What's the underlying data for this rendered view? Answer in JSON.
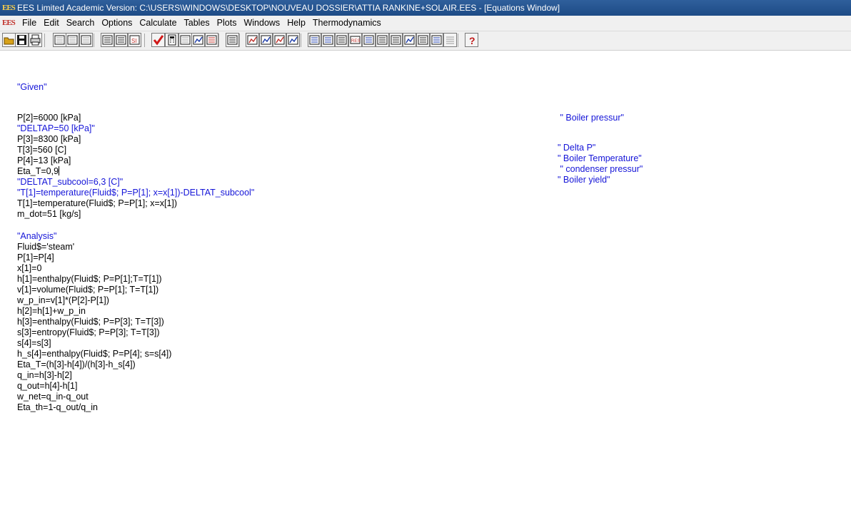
{
  "window": {
    "title": "EES Limited Academic Version:  C:\\USERS\\WINDOWS\\DESKTOP\\NOUVEAU DOSSIER\\ATTIA RANKINE+SOLAIR.EES - [Equations Window]",
    "logo_text": "EES"
  },
  "menubar": {
    "logo_text": "EES",
    "items": [
      "File",
      "Edit",
      "Search",
      "Options",
      "Calculate",
      "Tables",
      "Plots",
      "Windows",
      "Help",
      "Thermodynamics"
    ]
  },
  "toolbar": {
    "buttons": [
      {
        "name": "open-icon",
        "color": "#d8a21a"
      },
      {
        "name": "save-icon",
        "color": "#1a1a1a"
      },
      {
        "name": "print-icon",
        "color": "#1a1a1a"
      },
      {
        "name": "cut-icon",
        "color": "#9a9a9a"
      },
      {
        "name": "copy-icon",
        "color": "#9a9a9a"
      },
      {
        "name": "paste-icon",
        "color": "#9a9a9a"
      },
      {
        "name": "equations-icon",
        "color": "#1a1a1a"
      },
      {
        "name": "formatted-equations-icon",
        "color": "#1a1a1a"
      },
      {
        "name": "units-icon",
        "color": "#c0302a"
      },
      {
        "name": "check-icon",
        "color": "#d01818"
      },
      {
        "name": "calculator-icon",
        "color": "#1a1a1a"
      },
      {
        "name": "min-max-icon",
        "color": "#9a9a9a"
      },
      {
        "name": "plot-solve-icon",
        "color": "#1a3aa8"
      },
      {
        "name": "diagram-icon",
        "color": "#c0302a"
      },
      {
        "name": "parametric-table-icon",
        "color": "#1a1a1a"
      },
      {
        "name": "plot-1-icon",
        "color": "#c0302a"
      },
      {
        "name": "plot-2-icon",
        "color": "#1a3aa8"
      },
      {
        "name": "plot-3-icon",
        "color": "#c0302a"
      },
      {
        "name": "plot-4-icon",
        "color": "#1a3aa8"
      },
      {
        "name": "solution-icon",
        "color": "#1a3aa8"
      },
      {
        "name": "residuals-icon",
        "color": "#1a3aa8"
      },
      {
        "name": "arrays-icon",
        "color": "#1a1a1a"
      },
      {
        "name": "res-icon",
        "color": "#c0302a"
      },
      {
        "name": "integral-table-icon",
        "color": "#1a3aa8"
      },
      {
        "name": "lookup-table-icon",
        "color": "#1a1a1a"
      },
      {
        "name": "window-icon",
        "color": "#1a1a1a"
      },
      {
        "name": "plot-window-icon",
        "color": "#1a3aa8"
      },
      {
        "name": "grid-icon",
        "color": "#1a1a1a"
      },
      {
        "name": "picture-icon",
        "color": "#1a3aa8"
      },
      {
        "name": "align-icon",
        "color": "#9a9a9a"
      },
      {
        "name": "help-icon",
        "color": "#d8a21a"
      }
    ]
  },
  "equations": {
    "left": [
      {
        "text": "\"Given\"",
        "comment": true
      },
      {
        "text": "",
        "comment": false
      },
      {
        "text": "P[2]=6000 [kPa]",
        "comment": false
      },
      {
        "text": "\"DELTAP=50 [kPa]\"",
        "comment": true
      },
      {
        "text": "P[3]=8300 [kPa]",
        "comment": false
      },
      {
        "text": "T[3]=560 [C]",
        "comment": false
      },
      {
        "text": "P[4]=13 [kPa]",
        "comment": false
      },
      {
        "text": "Eta_T=0,9",
        "comment": false
      },
      {
        "text": "\"DELTAT_subcool=6,3 [C]\"",
        "comment": true
      },
      {
        "text": "\"T[1]=temperature(Fluid$; P=P[1]; x=x[1])-DELTAT_subcool\"",
        "comment": true
      },
      {
        "text": "T[1]=temperature(Fluid$; P=P[1]; x=x[1])",
        "comment": false
      },
      {
        "text": "m_dot=51 [kg/s]",
        "comment": false
      },
      {
        "text": "",
        "comment": false
      },
      {
        "text": "\"Analysis\"",
        "comment": true
      },
      {
        "text": "Fluid$='steam'",
        "comment": false
      },
      {
        "text": "P[1]=P[4]",
        "comment": false
      },
      {
        "text": "x[1]=0",
        "comment": false
      },
      {
        "text": "h[1]=enthalpy(Fluid$; P=P[1];T=T[1])",
        "comment": false
      },
      {
        "text": "v[1]=volume(Fluid$; P=P[1]; T=T[1])",
        "comment": false
      },
      {
        "text": "w_p_in=v[1]*(P[2]-P[1])",
        "comment": false
      },
      {
        "text": "h[2]=h[1]+w_p_in",
        "comment": false
      },
      {
        "text": "h[3]=enthalpy(Fluid$; P=P[3]; T=T[3])",
        "comment": false
      },
      {
        "text": "s[3]=entropy(Fluid$; P=P[3]; T=T[3])",
        "comment": false
      },
      {
        "text": "s[4]=s[3]",
        "comment": false
      },
      {
        "text": "h_s[4]=enthalpy(Fluid$; P=P[4]; s=s[4])",
        "comment": false
      },
      {
        "text": "Eta_T=(h[3]-h[4])/(h[3]-h_s[4])",
        "comment": false
      },
      {
        "text": "q_in=h[3]-h[2]",
        "comment": false
      },
      {
        "text": "q_out=h[4]-h[1]",
        "comment": false
      },
      {
        "text": "w_net=q_in-q_out",
        "comment": false
      },
      {
        "text": "Eta_th=1-q_out/q_in",
        "comment": false
      }
    ],
    "right": [
      {
        "text": " \" Boiler pressur\"",
        "line": 2
      },
      {
        "text": "\" Delta P\"",
        "line": 4
      },
      {
        "text": "\" Boiler Temperature\"",
        "line": 5
      },
      {
        "text": " \" condenser pressur\"",
        "line": 6
      },
      {
        "text": "\" Boiler yield\"",
        "line": 7
      }
    ]
  }
}
